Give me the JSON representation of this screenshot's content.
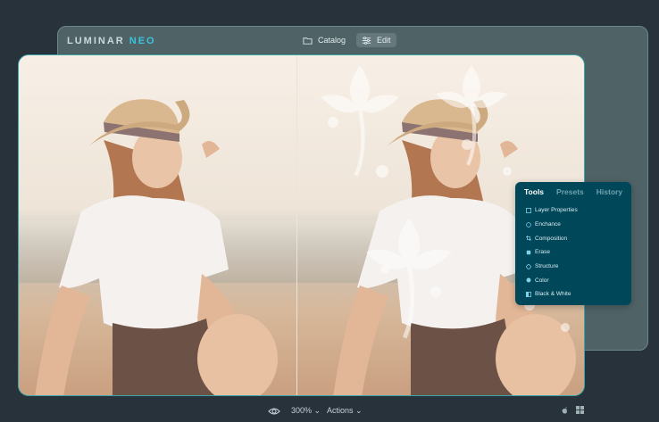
{
  "app": {
    "logo_main": "LUMINAR",
    "logo_accent": "NEO"
  },
  "nav": {
    "catalog_label": "Catalog",
    "edit_label": "Edit"
  },
  "panel": {
    "tabs": [
      {
        "label": "Tools",
        "active": true
      },
      {
        "label": "Presets",
        "active": false
      },
      {
        "label": "History",
        "active": false
      }
    ],
    "tools": [
      {
        "label": "Layer Properties",
        "icon": "layers-icon"
      },
      {
        "label": "Enchance",
        "icon": "enhance-icon"
      },
      {
        "label": "Composition",
        "icon": "crop-icon"
      },
      {
        "label": "Erase",
        "icon": "eraser-icon"
      },
      {
        "label": "Structure",
        "icon": "structure-icon"
      },
      {
        "label": "Color",
        "icon": "color-icon"
      },
      {
        "label": "Black & White",
        "icon": "bw-icon"
      }
    ]
  },
  "bottom": {
    "zoom_label": "300%",
    "actions_label": "Actions"
  },
  "colors": {
    "background": "#27323a",
    "window": "#4f6366",
    "panel": "#00475a",
    "accent": "#39c3dd"
  }
}
